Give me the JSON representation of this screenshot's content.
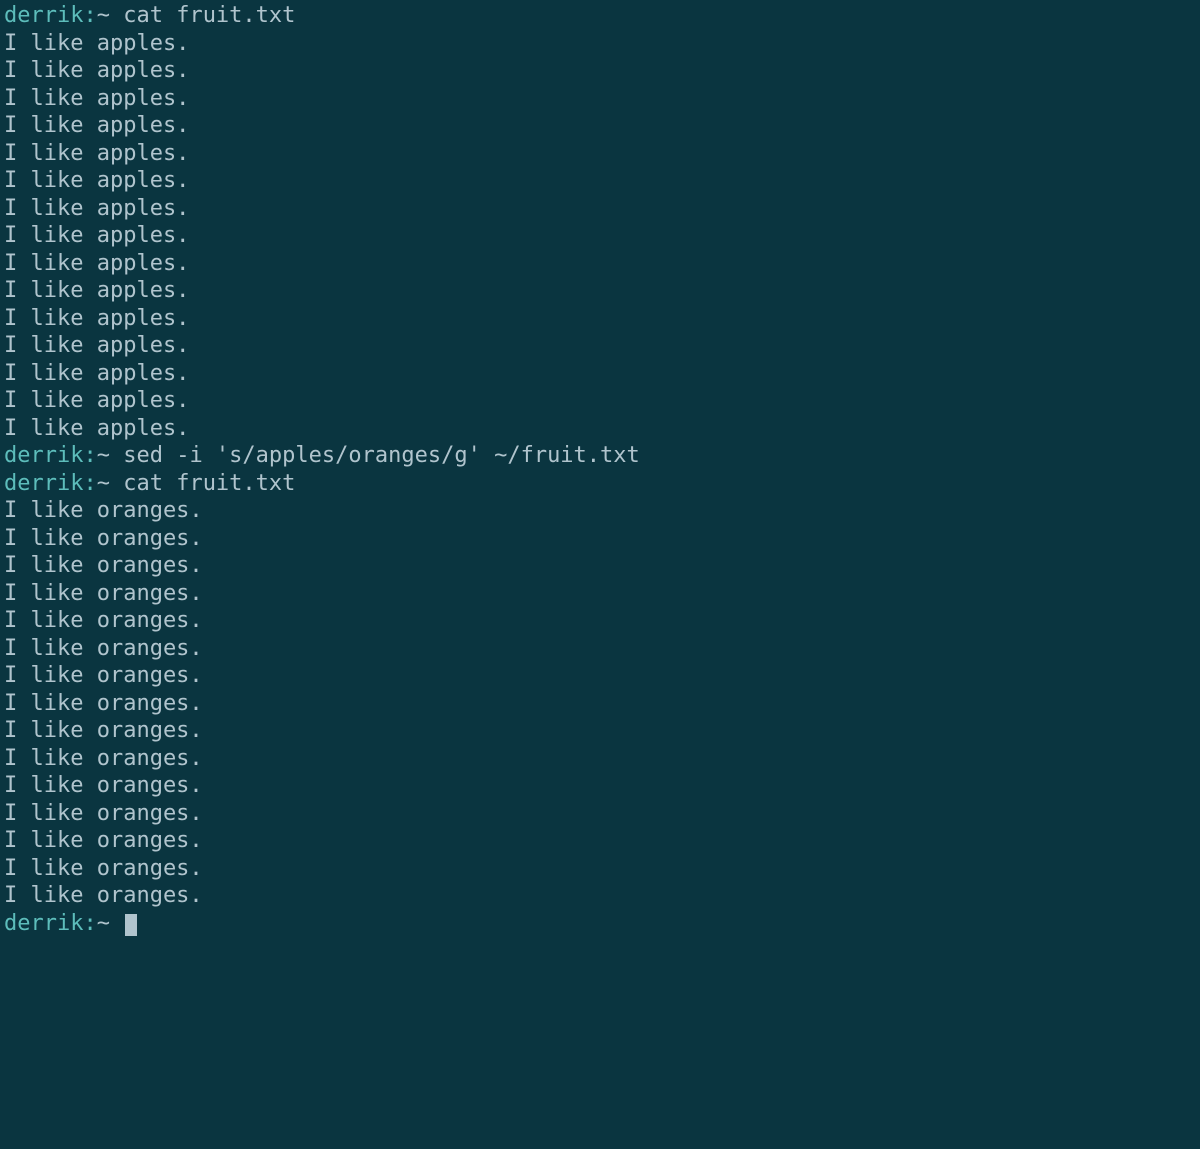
{
  "prompt": {
    "user_host": "derrik:",
    "path": "~",
    "separator": " "
  },
  "session": [
    {
      "type": "command",
      "text": "cat fruit.txt"
    },
    {
      "type": "output",
      "text": "I like apples."
    },
    {
      "type": "output",
      "text": "I like apples."
    },
    {
      "type": "output",
      "text": "I like apples."
    },
    {
      "type": "output",
      "text": "I like apples."
    },
    {
      "type": "output",
      "text": "I like apples."
    },
    {
      "type": "output",
      "text": "I like apples."
    },
    {
      "type": "output",
      "text": "I like apples."
    },
    {
      "type": "output",
      "text": "I like apples."
    },
    {
      "type": "output",
      "text": "I like apples."
    },
    {
      "type": "output",
      "text": "I like apples."
    },
    {
      "type": "output",
      "text": "I like apples."
    },
    {
      "type": "output",
      "text": "I like apples."
    },
    {
      "type": "output",
      "text": "I like apples."
    },
    {
      "type": "output",
      "text": "I like apples."
    },
    {
      "type": "output",
      "text": "I like apples."
    },
    {
      "type": "command",
      "text": "sed -i 's/apples/oranges/g' ~/fruit.txt"
    },
    {
      "type": "command",
      "text": "cat fruit.txt"
    },
    {
      "type": "output",
      "text": "I like oranges."
    },
    {
      "type": "output",
      "text": "I like oranges."
    },
    {
      "type": "output",
      "text": "I like oranges."
    },
    {
      "type": "output",
      "text": "I like oranges."
    },
    {
      "type": "output",
      "text": "I like oranges."
    },
    {
      "type": "output",
      "text": "I like oranges."
    },
    {
      "type": "output",
      "text": "I like oranges."
    },
    {
      "type": "output",
      "text": "I like oranges."
    },
    {
      "type": "output",
      "text": "I like oranges."
    },
    {
      "type": "output",
      "text": "I like oranges."
    },
    {
      "type": "output",
      "text": "I like oranges."
    },
    {
      "type": "output",
      "text": "I like oranges."
    },
    {
      "type": "output",
      "text": "I like oranges."
    },
    {
      "type": "output",
      "text": "I like oranges."
    },
    {
      "type": "output",
      "text": "I like oranges."
    },
    {
      "type": "prompt_cursor"
    }
  ]
}
